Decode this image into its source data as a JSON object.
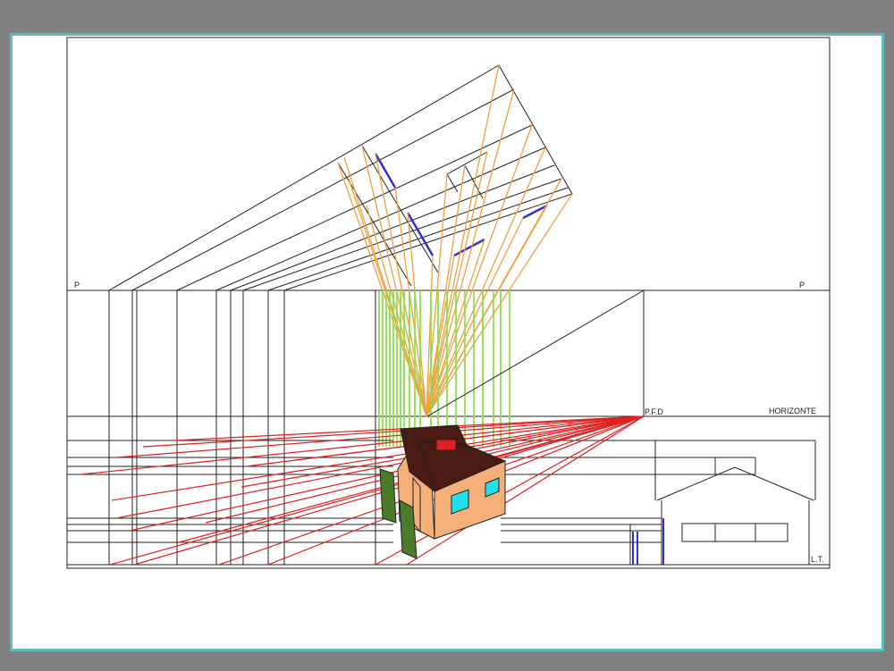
{
  "labels": {
    "picture_plane_left": "P",
    "picture_plane_right": "P",
    "vanishing_point": "P.F.D",
    "horizon": "HORIZONTE",
    "ground_line": "L.T."
  },
  "colors": {
    "background": "#808080",
    "sheet": "#ffffff",
    "sheet_border": "#5bbdbd",
    "line": "#222222",
    "orange_rays": "#f0a040",
    "green_rays": "#8ee04a",
    "red_rays": "#e02020",
    "blue_marks": "#3333cc",
    "house_wall": "#f5b07a",
    "house_roof": "#4a1a14",
    "house_window": "#22e0e8",
    "chimney": "#e02020",
    "hedge": "#4a7a2a"
  }
}
